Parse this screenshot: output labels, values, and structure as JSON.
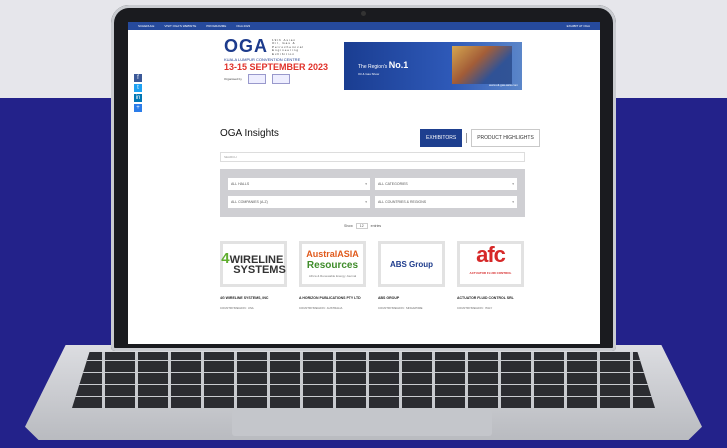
{
  "nav": {
    "items": [
      "SCHEDULE",
      "VISIT OGA'S WEBSITE",
      "PROGRAMME",
      "OGA 2023"
    ],
    "right": "EXHIBIT AT OGA"
  },
  "social": [
    "f",
    "t",
    "in",
    "+"
  ],
  "header": {
    "logo": "OGA",
    "logo_sub": "19th Asian Oil, Gas & Petrochemical Engineering Exhibition",
    "venue": "KUALA LUMPUR CONVENTION CENTRE",
    "dates": "13-15 SEPTEMBER 2023",
    "organised_by": "Organised by"
  },
  "banner": {
    "line1_pre": "The Region's",
    "line1_bold": "No.1",
    "line2": "Oil & Gas Show",
    "url": "www.oil-gas-asia.com"
  },
  "page": {
    "title": "OGA Insights",
    "tab_exhibitors": "EXHIBITORS",
    "tab_highlights": "PRODUCT HIGHLIGHTS",
    "search_placeholder": "SEARCH",
    "filter_halls": "ALL HALLS",
    "filter_categories": "ALL CATEGORIES",
    "filter_companies": "ALL COMPANIES (A-Z)",
    "filter_countries": "ALL COUNTRIES & REGIONS",
    "show_label": "Show",
    "show_value": "12",
    "show_suffix": "entries"
  },
  "cards": [
    {
      "name": "4G WIRELINE SYSTEMS, INC",
      "country": "COUNTRY/REGION : USA",
      "logo_a": "WIRELINE",
      "logo_b": "SYSTEMS"
    },
    {
      "name": "A HORIZON PUBLICATIONS PTY LTD",
      "country": "COUNTRY/REGION : AUSTRALIA",
      "logo_a": "AustralASIA",
      "logo_b": "Resources",
      "logo_c": "Africa & Renewable Energy Journal"
    },
    {
      "name": "ABS GROUP",
      "country": "COUNTRY/REGION : SINGAPORE",
      "logo_a": "ABS Group"
    },
    {
      "name": "ACTUATOR FLUID CONTROL SRL",
      "country": "COUNTRY/REGION : ITALY",
      "logo_a": "afc",
      "logo_b": "ACTUATOR FLUID CONTROL"
    }
  ]
}
